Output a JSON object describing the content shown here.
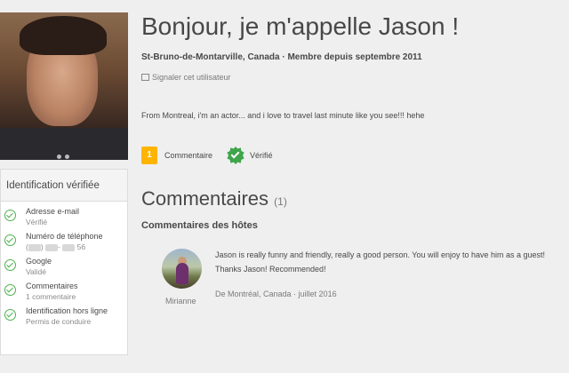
{
  "profile": {
    "title": "Bonjour, je m'appelle Jason !",
    "subline": "St-Bruno-de-Montarville, Canada · Membre depuis septembre 2011",
    "report_label": "Signaler cet utilisateur",
    "bio": "From Montreal, i'm an actor... and i love to travel last minute like you see!!! hehe"
  },
  "badges": {
    "comments_count": "1",
    "comments_label": "Commentaire",
    "verified_label": "Vérifié"
  },
  "verification": {
    "title": "Identification vérifiée",
    "items": [
      {
        "title": "Adresse e-mail",
        "status": "Vérifié"
      },
      {
        "title": "Numéro de téléphone",
        "status": "56"
      },
      {
        "title": "Google",
        "status": "Validé"
      },
      {
        "title": "Commentaires",
        "status": "1 commentaire"
      },
      {
        "title": "Identification hors ligne",
        "status": "Permis de conduire"
      }
    ]
  },
  "comments": {
    "heading": "Commentaires",
    "count": "(1)",
    "hosts_heading": "Commentaires des hôtes",
    "reviews": [
      {
        "author": "Mirianne",
        "text": "Jason is really funny and friendly, really a good person. You will enjoy to have him as a guest! Thanks Jason! Recommended!",
        "meta": "De Montréal, Canada · juillet 2016"
      }
    ]
  },
  "colors": {
    "accent_green": "#3fa54b",
    "badge_yellow": "#ffb400",
    "text": "#484848",
    "muted": "#7a7a7a"
  }
}
